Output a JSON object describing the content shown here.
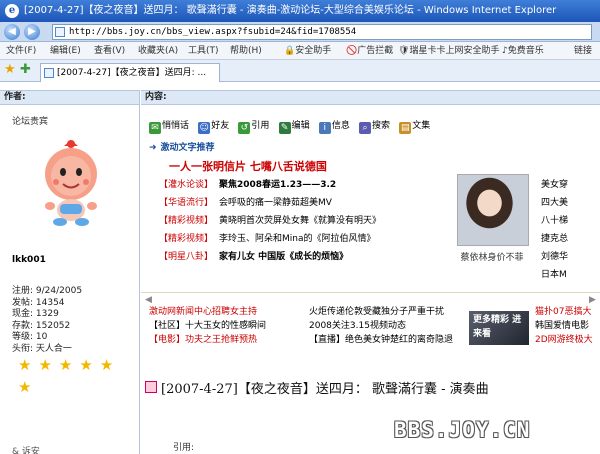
{
  "window": {
    "title": "[2007-4-27]【夜之夜音】送四月： 歌聲滿行囊 - 演奏曲-激动论坛-大型综合美娱乐论坛 - Windows Internet Explorer"
  },
  "address_bar": {
    "url": "http://bbs.joy.cn/bbs_view.aspx?fsubid=24&fid=1708554"
  },
  "menu": {
    "items": [
      "文件(F)",
      "编辑(E)",
      "查看(V)",
      "收藏夹(A)",
      "工具(T)",
      "帮助(H)"
    ],
    "toolbar_items": [
      "安全助手",
      "广告拦截",
      "瑞星卡卡上网安全助手",
      "免费音乐",
      "链接"
    ]
  },
  "tab": {
    "label": "[2007-4-27]【夜之夜音】送四月: ..."
  },
  "columns": {
    "author_header": "作者:",
    "content_header": "内容:"
  },
  "user": {
    "rank": "论坛贵宾",
    "username": "lkk001",
    "stats": [
      "注册: 9/24/2005",
      "发帖: 14354",
      "现金: 1329",
      "存款: 152052",
      "等级: 10",
      "头衔: 天人合一"
    ],
    "stars": 6
  },
  "post_tools": [
    "悄悄话",
    "好友",
    "引用",
    "编辑",
    "信息",
    "搜索",
    "文集"
  ],
  "recommend_label": "激动文字推荐",
  "ad": {
    "title": "一人一张明信片 七嘴八舌说德国",
    "rows": [
      {
        "cat": "【灌水论谈】",
        "text": "聚焦2008春运1.23——3.2"
      },
      {
        "cat": "【华语流行】",
        "text": "会呼吸的痛一梁静茹超美MV"
      },
      {
        "cat": "【精彩视频】",
        "text": "黄晓明首次荧屏处女舞《就算没有明天》"
      },
      {
        "cat": "【精彩视频】",
        "text": "李玲玉、阿朵和Mina的《阿拉伯风情》"
      },
      {
        "cat": "【明星八卦】",
        "text": "家有儿女 中国版《成长的烦恼》"
      }
    ],
    "photo_caption": "蔡依林身价不菲",
    "right_list": [
      "美女穿",
      "四大美",
      "八十梯",
      "捷克总",
      "刘德华",
      "日本M"
    ]
  },
  "news": {
    "col1": [
      "激动网新闻中心招聘女主持",
      "【社区】十大玉女的性感瞬间",
      "【电影】功夫之王抢鲜预热"
    ],
    "col2": [
      "火炬传递伦敦受藏独分子严重干扰",
      "2008关注3.15视频动态",
      "【直播】绝色美女钟楚红的离奇隐退"
    ],
    "movie_text": "更多精彩 进来看",
    "col3": [
      "猫扑07恶搞大",
      "韩国爱情电影",
      "2D网游终极大"
    ]
  },
  "post": {
    "title": "[2007-4-27]【夜之夜音】送四月： 歌聲滿行囊 - 演奏曲",
    "quote_label": "引用:"
  },
  "bottom_left": "& 诉安",
  "watermark": "BBS.JOY.CN"
}
